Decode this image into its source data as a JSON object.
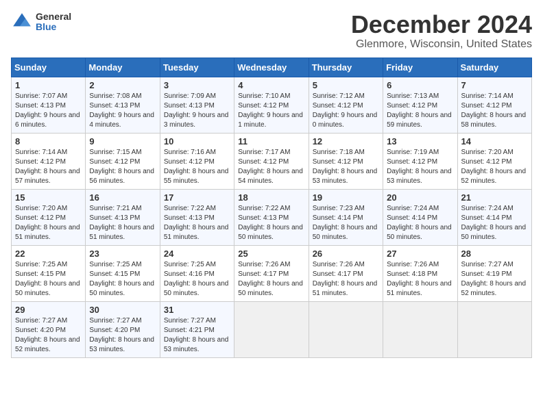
{
  "logo": {
    "general": "General",
    "blue": "Blue"
  },
  "title": {
    "month": "December 2024",
    "location": "Glenmore, Wisconsin, United States"
  },
  "headers": [
    "Sunday",
    "Monday",
    "Tuesday",
    "Wednesday",
    "Thursday",
    "Friday",
    "Saturday"
  ],
  "weeks": [
    [
      {
        "day": "1",
        "sunrise": "7:07 AM",
        "sunset": "4:13 PM",
        "daylight": "9 hours and 6 minutes."
      },
      {
        "day": "2",
        "sunrise": "7:08 AM",
        "sunset": "4:13 PM",
        "daylight": "9 hours and 4 minutes."
      },
      {
        "day": "3",
        "sunrise": "7:09 AM",
        "sunset": "4:13 PM",
        "daylight": "9 hours and 3 minutes."
      },
      {
        "day": "4",
        "sunrise": "7:10 AM",
        "sunset": "4:12 PM",
        "daylight": "9 hours and 1 minute."
      },
      {
        "day": "5",
        "sunrise": "7:12 AM",
        "sunset": "4:12 PM",
        "daylight": "9 hours and 0 minutes."
      },
      {
        "day": "6",
        "sunrise": "7:13 AM",
        "sunset": "4:12 PM",
        "daylight": "8 hours and 59 minutes."
      },
      {
        "day": "7",
        "sunrise": "7:14 AM",
        "sunset": "4:12 PM",
        "daylight": "8 hours and 58 minutes."
      }
    ],
    [
      {
        "day": "8",
        "sunrise": "7:14 AM",
        "sunset": "4:12 PM",
        "daylight": "8 hours and 57 minutes."
      },
      {
        "day": "9",
        "sunrise": "7:15 AM",
        "sunset": "4:12 PM",
        "daylight": "8 hours and 56 minutes."
      },
      {
        "day": "10",
        "sunrise": "7:16 AM",
        "sunset": "4:12 PM",
        "daylight": "8 hours and 55 minutes."
      },
      {
        "day": "11",
        "sunrise": "7:17 AM",
        "sunset": "4:12 PM",
        "daylight": "8 hours and 54 minutes."
      },
      {
        "day": "12",
        "sunrise": "7:18 AM",
        "sunset": "4:12 PM",
        "daylight": "8 hours and 53 minutes."
      },
      {
        "day": "13",
        "sunrise": "7:19 AM",
        "sunset": "4:12 PM",
        "daylight": "8 hours and 53 minutes."
      },
      {
        "day": "14",
        "sunrise": "7:20 AM",
        "sunset": "4:12 PM",
        "daylight": "8 hours and 52 minutes."
      }
    ],
    [
      {
        "day": "15",
        "sunrise": "7:20 AM",
        "sunset": "4:12 PM",
        "daylight": "8 hours and 51 minutes."
      },
      {
        "day": "16",
        "sunrise": "7:21 AM",
        "sunset": "4:13 PM",
        "daylight": "8 hours and 51 minutes."
      },
      {
        "day": "17",
        "sunrise": "7:22 AM",
        "sunset": "4:13 PM",
        "daylight": "8 hours and 51 minutes."
      },
      {
        "day": "18",
        "sunrise": "7:22 AM",
        "sunset": "4:13 PM",
        "daylight": "8 hours and 50 minutes."
      },
      {
        "day": "19",
        "sunrise": "7:23 AM",
        "sunset": "4:14 PM",
        "daylight": "8 hours and 50 minutes."
      },
      {
        "day": "20",
        "sunrise": "7:24 AM",
        "sunset": "4:14 PM",
        "daylight": "8 hours and 50 minutes."
      },
      {
        "day": "21",
        "sunrise": "7:24 AM",
        "sunset": "4:14 PM",
        "daylight": "8 hours and 50 minutes."
      }
    ],
    [
      {
        "day": "22",
        "sunrise": "7:25 AM",
        "sunset": "4:15 PM",
        "daylight": "8 hours and 50 minutes."
      },
      {
        "day": "23",
        "sunrise": "7:25 AM",
        "sunset": "4:15 PM",
        "daylight": "8 hours and 50 minutes."
      },
      {
        "day": "24",
        "sunrise": "7:25 AM",
        "sunset": "4:16 PM",
        "daylight": "8 hours and 50 minutes."
      },
      {
        "day": "25",
        "sunrise": "7:26 AM",
        "sunset": "4:17 PM",
        "daylight": "8 hours and 50 minutes."
      },
      {
        "day": "26",
        "sunrise": "7:26 AM",
        "sunset": "4:17 PM",
        "daylight": "8 hours and 51 minutes."
      },
      {
        "day": "27",
        "sunrise": "7:26 AM",
        "sunset": "4:18 PM",
        "daylight": "8 hours and 51 minutes."
      },
      {
        "day": "28",
        "sunrise": "7:27 AM",
        "sunset": "4:19 PM",
        "daylight": "8 hours and 52 minutes."
      }
    ],
    [
      {
        "day": "29",
        "sunrise": "7:27 AM",
        "sunset": "4:20 PM",
        "daylight": "8 hours and 52 minutes."
      },
      {
        "day": "30",
        "sunrise": "7:27 AM",
        "sunset": "4:20 PM",
        "daylight": "8 hours and 53 minutes."
      },
      {
        "day": "31",
        "sunrise": "7:27 AM",
        "sunset": "4:21 PM",
        "daylight": "8 hours and 53 minutes."
      },
      null,
      null,
      null,
      null
    ]
  ]
}
